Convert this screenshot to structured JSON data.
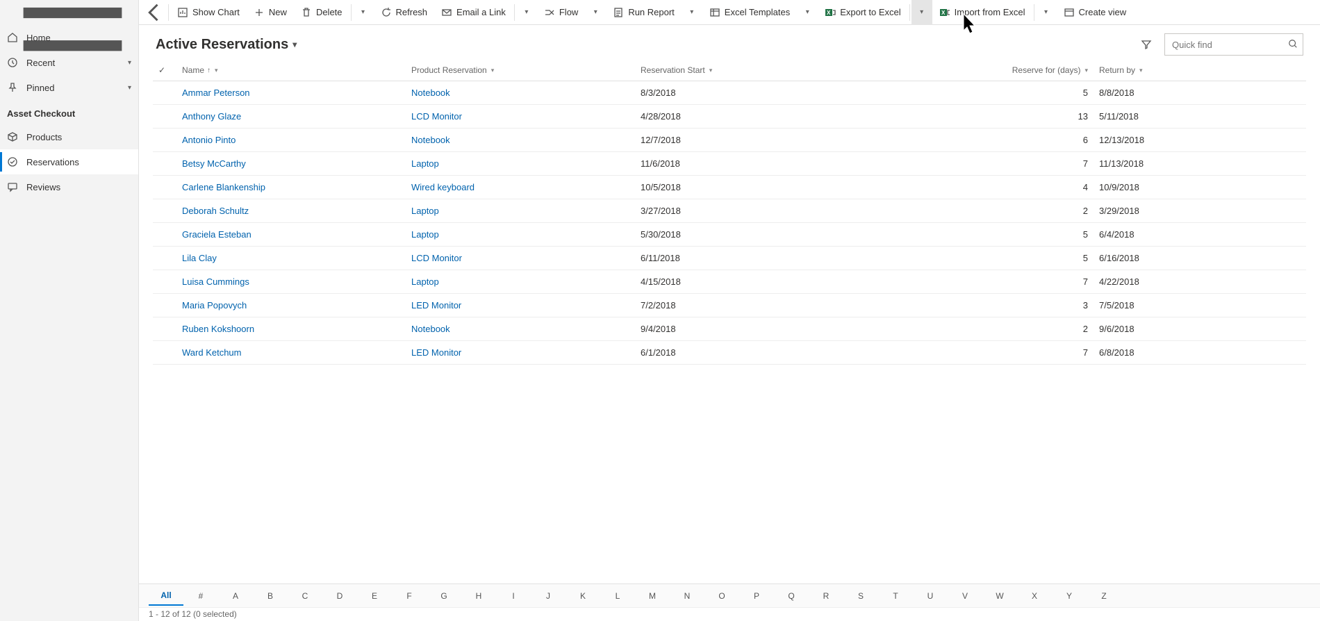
{
  "sidebar": {
    "home": "Home",
    "recent": "Recent",
    "pinned": "Pinned",
    "section": "Asset Checkout",
    "products": "Products",
    "reservations": "Reservations",
    "reviews": "Reviews"
  },
  "cmd": {
    "show_chart": "Show Chart",
    "new": "New",
    "delete": "Delete",
    "refresh": "Refresh",
    "email_link": "Email a Link",
    "flow": "Flow",
    "run_report": "Run Report",
    "excel_templates": "Excel Templates",
    "export_excel": "Export to Excel",
    "import_excel": "Import from Excel",
    "create_view": "Create view"
  },
  "header": {
    "title": "Active Reservations",
    "search_placeholder": "Quick find"
  },
  "columns": {
    "name": "Name",
    "product": "Product Reservation",
    "start": "Reservation Start",
    "reserve_for": "Reserve for (days)",
    "return_by": "Return by"
  },
  "rows": [
    {
      "name": "Ammar Peterson",
      "product": "Notebook",
      "start": "8/3/2018",
      "days": "5",
      "return": "8/8/2018"
    },
    {
      "name": "Anthony Glaze",
      "product": "LCD Monitor",
      "start": "4/28/2018",
      "days": "13",
      "return": "5/11/2018"
    },
    {
      "name": "Antonio Pinto",
      "product": "Notebook",
      "start": "12/7/2018",
      "days": "6",
      "return": "12/13/2018"
    },
    {
      "name": "Betsy McCarthy",
      "product": "Laptop",
      "start": "11/6/2018",
      "days": "7",
      "return": "11/13/2018"
    },
    {
      "name": "Carlene Blankenship",
      "product": "Wired keyboard",
      "start": "10/5/2018",
      "days": "4",
      "return": "10/9/2018"
    },
    {
      "name": "Deborah Schultz",
      "product": "Laptop",
      "start": "3/27/2018",
      "days": "2",
      "return": "3/29/2018"
    },
    {
      "name": "Graciela Esteban",
      "product": "Laptop",
      "start": "5/30/2018",
      "days": "5",
      "return": "6/4/2018"
    },
    {
      "name": "Lila Clay",
      "product": "LCD Monitor",
      "start": "6/11/2018",
      "days": "5",
      "return": "6/16/2018"
    },
    {
      "name": "Luisa Cummings",
      "product": "Laptop",
      "start": "4/15/2018",
      "days": "7",
      "return": "4/22/2018"
    },
    {
      "name": "Maria Popovych",
      "product": "LED Monitor",
      "start": "7/2/2018",
      "days": "3",
      "return": "7/5/2018"
    },
    {
      "name": "Ruben Kokshoorn",
      "product": "Notebook",
      "start": "9/4/2018",
      "days": "2",
      "return": "9/6/2018"
    },
    {
      "name": "Ward Ketchum",
      "product": "LED Monitor",
      "start": "6/1/2018",
      "days": "7",
      "return": "6/8/2018"
    }
  ],
  "alpha": [
    "All",
    "#",
    "A",
    "B",
    "C",
    "D",
    "E",
    "F",
    "G",
    "H",
    "I",
    "J",
    "K",
    "L",
    "M",
    "N",
    "O",
    "P",
    "Q",
    "R",
    "S",
    "T",
    "U",
    "V",
    "W",
    "X",
    "Y",
    "Z"
  ],
  "status": "1 - 12 of 12 (0 selected)"
}
